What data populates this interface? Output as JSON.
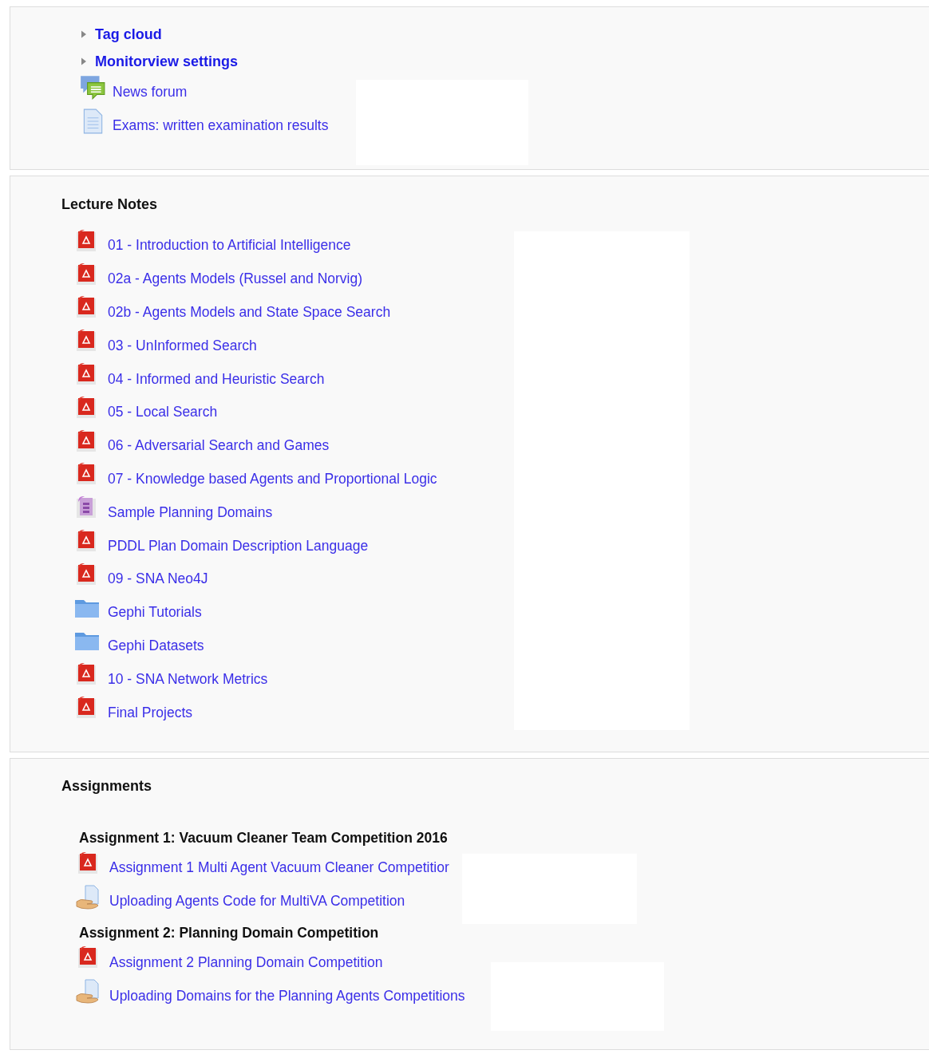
{
  "top_section": {
    "toggles": [
      {
        "label": "Tag cloud",
        "expanded": false
      },
      {
        "label": "Monitorview settings",
        "expanded": false
      }
    ],
    "items": [
      {
        "kind": "forum",
        "label": "News forum"
      },
      {
        "kind": "page",
        "label": "Exams: written examination results"
      }
    ]
  },
  "sections": [
    {
      "title": "Lecture Notes",
      "groups": [
        {
          "items": [
            {
              "kind": "pdf",
              "label": "01 - Introduction to Artificial Intelligence"
            },
            {
              "kind": "pdf",
              "label": "02a - Agents Models (Russel and Norvig)"
            },
            {
              "kind": "pdf",
              "label": "02b - Agents Models and State Space Search"
            },
            {
              "kind": "pdf",
              "label": "03 - UnInformed Search"
            },
            {
              "kind": "pdf",
              "label": "04 - Informed and Heuristic Search"
            },
            {
              "kind": "pdf",
              "label": "05 - Local Search"
            },
            {
              "kind": "pdf",
              "label": "06 - Adversarial Search and Games"
            },
            {
              "kind": "pdf",
              "label": "07 - Knowledge based Agents and Proportional Logic"
            },
            {
              "kind": "archive",
              "label": "Sample Planning Domains"
            },
            {
              "kind": "pdf",
              "label": "PDDL Plan Domain Description Language"
            },
            {
              "kind": "pdf",
              "label": "09 - SNA Neo4J"
            },
            {
              "kind": "folder",
              "label": "Gephi Tutorials"
            },
            {
              "kind": "folder",
              "label": "Gephi Datasets"
            },
            {
              "kind": "pdf",
              "label": "10 - SNA Network Metrics"
            },
            {
              "kind": "pdf",
              "label": "Final Projects"
            }
          ]
        }
      ]
    },
    {
      "title": "Assignments",
      "groups": [
        {
          "heading": "Assignment 1: Vacuum Cleaner Team Competition 2016",
          "items": [
            {
              "kind": "pdf",
              "label": "Assignment 1 Multi Agent Vacuum Cleaner Competitior"
            },
            {
              "kind": "assign",
              "label": "Uploading Agents Code for MultiVA Competition"
            }
          ]
        },
        {
          "heading": "Assignment 2: Planning Domain Competition",
          "items": [
            {
              "kind": "pdf",
              "label": "Assignment 2 Planning Domain Competition"
            },
            {
              "kind": "assign",
              "label": "Uploading Domains for the Planning Agents Competitions"
            }
          ]
        }
      ]
    }
  ]
}
